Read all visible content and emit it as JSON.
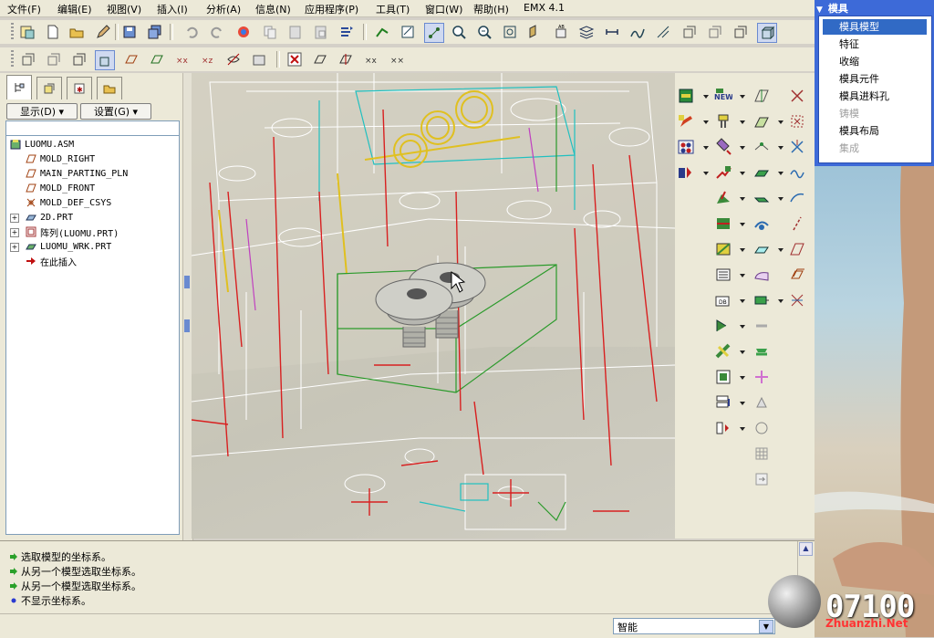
{
  "menubar": {
    "items": [
      "文件(F)",
      "编辑(E)",
      "视图(V)",
      "插入(I)",
      "分析(A)",
      "信息(N)",
      "应用程序(P)",
      "工具(T)",
      "窗口(W)",
      "帮助(H)",
      "EMX 4.1"
    ]
  },
  "left_panel": {
    "tabs": [
      "model-tree-icon",
      "layers-icon",
      "favorites-icon",
      "folder-icon"
    ],
    "show_button": "显示(D) ▾",
    "settings_button": "设置(G) ▾",
    "tree": [
      {
        "label": "LUOMU.ASM",
        "icon": "assembly-icon",
        "level": 0,
        "expandable": false
      },
      {
        "label": "MOLD_RIGHT",
        "icon": "datum-plane-icon",
        "level": 1,
        "expandable": false
      },
      {
        "label": "MAIN_PARTING_PLN",
        "icon": "datum-plane-icon",
        "level": 1,
        "expandable": false
      },
      {
        "label": "MOLD_FRONT",
        "icon": "datum-plane-icon",
        "level": 1,
        "expandable": false
      },
      {
        "label": "MOLD_DEF_CSYS",
        "icon": "csys-icon",
        "level": 1,
        "expandable": false
      },
      {
        "label": "2D.PRT",
        "icon": "part-icon",
        "level": 1,
        "expandable": true
      },
      {
        "label": "阵列(LUOMU.PRT)",
        "icon": "pattern-icon",
        "level": 1,
        "expandable": true
      },
      {
        "label": "LUOMU_WRK.PRT",
        "icon": "workpiece-icon",
        "level": 1,
        "expandable": true
      },
      {
        "label": "在此插入",
        "icon": "insert-here-arrow-icon",
        "level": 1,
        "expandable": false
      }
    ]
  },
  "messages": [
    {
      "icon": "prompt-arrow-icon",
      "text": "选取模型的坐标系。"
    },
    {
      "icon": "prompt-arrow-icon",
      "text": "从另一个模型选取坐标系。"
    },
    {
      "icon": "prompt-arrow-icon",
      "text": "从另一个模型选取坐标系。"
    },
    {
      "icon": "info-dot-icon",
      "text": "不显示坐标系。"
    }
  ],
  "status": {
    "filter": "智能"
  },
  "menu_manager": {
    "title": "模具",
    "items": [
      {
        "label": "模具模型",
        "state": "selected"
      },
      {
        "label": "特征",
        "state": "enabled"
      },
      {
        "label": "收缩",
        "state": "enabled"
      },
      {
        "label": "模具元件",
        "state": "enabled"
      },
      {
        "label": "模具进料孔",
        "state": "enabled"
      },
      {
        "label": "铸模",
        "state": "disabled"
      },
      {
        "label": "模具布局",
        "state": "enabled"
      },
      {
        "label": "集成",
        "state": "disabled"
      }
    ]
  },
  "watermark": {
    "number": "07100",
    "site": "Zhuanzhi.Net"
  },
  "colors": {
    "menu_blue": "#3d6ad8",
    "selection": "#316ac5",
    "wire_red": "#d82020",
    "wire_green": "#2a9a2a",
    "wire_yellow": "#e0c020",
    "wire_cyan": "#20c0c0",
    "wire_white": "#ffffff"
  }
}
